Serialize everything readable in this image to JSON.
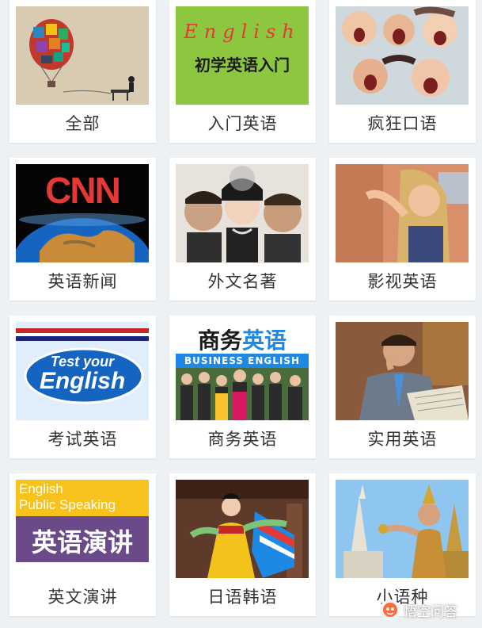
{
  "categories": [
    {
      "label": "全部",
      "icon": "hot-air-balloon-reading-image"
    },
    {
      "label": "入门英语",
      "icon": "beginner-english-cover-image",
      "overlay_script": "English",
      "overlay_title": "初学英语入门"
    },
    {
      "label": "疯狂口语",
      "icon": "shouting-people-image"
    },
    {
      "label": "英语新闻",
      "icon": "cnn-globe-image",
      "overlay_logo": "CNN"
    },
    {
      "label": "外文名著",
      "icon": "classic-film-stars-image"
    },
    {
      "label": "影视英语",
      "icon": "tv-actress-image"
    },
    {
      "label": "考试英语",
      "icon": "test-your-english-image",
      "overlay_line1": "Test your",
      "overlay_line2": "English"
    },
    {
      "label": "商务英语",
      "icon": "business-english-image",
      "overlay_title_a": "商务",
      "overlay_title_b": "英语",
      "overlay_banner": "BUSINESS ENGLISH"
    },
    {
      "label": "实用英语",
      "icon": "businessman-newspaper-image"
    },
    {
      "label": "英文演讲",
      "icon": "public-speaking-image",
      "overlay_line1": "English",
      "overlay_line2": "Public Speaking",
      "overlay_title": "英语演讲"
    },
    {
      "label": "日语韩语",
      "icon": "korean-hanbok-dancer-image"
    },
    {
      "label": "小语种",
      "icon": "thai-dancer-temple-image"
    }
  ],
  "watermark": {
    "text": "悟空问答"
  },
  "colors": {
    "background": "#eef1f4",
    "card": "#ffffff",
    "label": "#333333",
    "green": "#8dc63f",
    "purple": "#6b4a8a",
    "yellow": "#f7c21b"
  }
}
